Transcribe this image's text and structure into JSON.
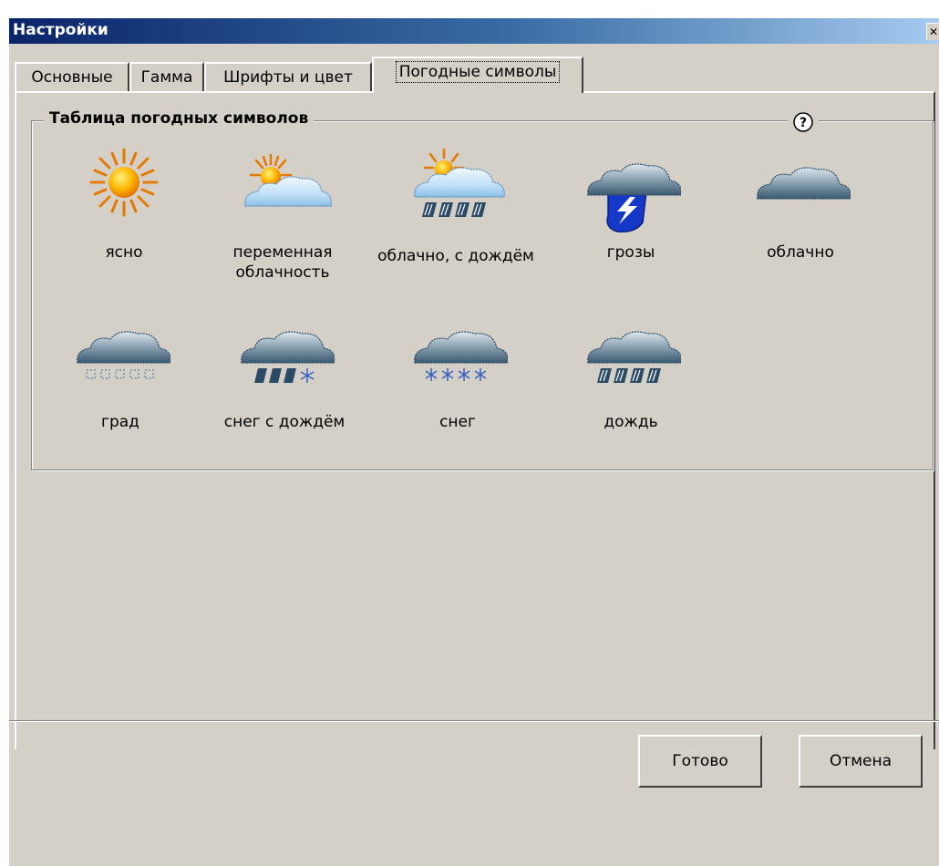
{
  "window": {
    "title": "Настройки",
    "close_glyph": "✕"
  },
  "tabs": [
    {
      "label": "Основные",
      "active": false
    },
    {
      "label": "Гамма",
      "active": false
    },
    {
      "label": "Шрифты и цвет",
      "active": false
    },
    {
      "label": "Погодные символы",
      "active": true
    }
  ],
  "group": {
    "title": "Таблица погодных символов",
    "help_icon": "help-icon"
  },
  "symbols": [
    {
      "label": "ясно",
      "icon": "sun-icon"
    },
    {
      "label": "переменная облачность",
      "icon": "partly-cloudy-icon"
    },
    {
      "label": "облачно, с дождём",
      "icon": "cloudy-rain-icon"
    },
    {
      "label": "грозы",
      "icon": "thunderstorm-icon"
    },
    {
      "label": "облачно",
      "icon": "cloud-icon"
    },
    {
      "label": "град",
      "icon": "hail-icon"
    },
    {
      "label": "снег с дождём",
      "icon": "sleet-icon"
    },
    {
      "label": "снег",
      "icon": "snow-icon"
    },
    {
      "label": "дождь",
      "icon": "rain-icon"
    }
  ],
  "buttons": {
    "ok": "Готово",
    "cancel": "Отмена"
  }
}
